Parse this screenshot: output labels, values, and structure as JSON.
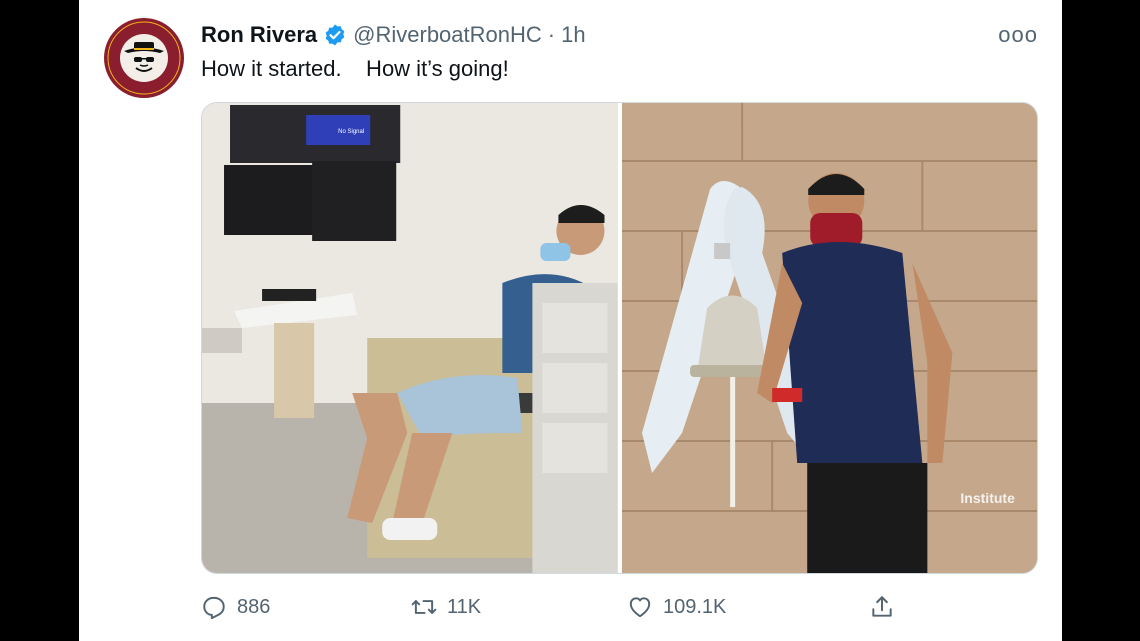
{
  "tweet": {
    "author_name": "Ron Rivera",
    "handle": "@RiverboatRonHC",
    "separator": "·",
    "time": "1h",
    "more_label": "ooo",
    "text": "How it started.    How it’s going!",
    "avatar_ring_text": "RIVERBOAT RON"
  },
  "media": {
    "left_photo": {
      "sign_text": "No Signal"
    },
    "right_photo": {
      "wall_text": "Institute"
    }
  },
  "actions": {
    "replies": "886",
    "retweets": "11K",
    "likes": "109.1K"
  },
  "colors": {
    "verified_badge": "#1d9bf0",
    "avatar_bg": "#8b1e2e",
    "avatar_ring": "#f2b51c"
  }
}
